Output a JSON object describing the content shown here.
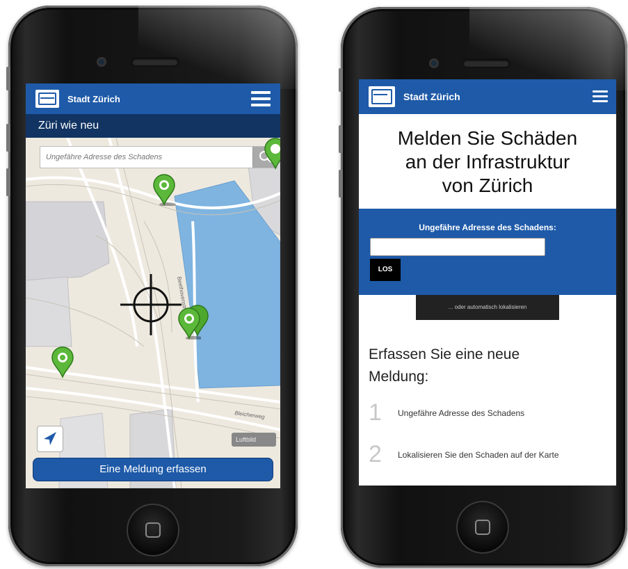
{
  "left_app": {
    "brand": "Stadt Zürich",
    "subtitle": "Züri wie neu",
    "search_placeholder": "Ungefähre Adresse des Schadens",
    "layer_toggle": "Luftbild",
    "street_labels": [
      "Beethovenstrasse",
      "Bleicherweg"
    ],
    "report_button": "Eine Meldung erfassen"
  },
  "right_app": {
    "brand": "Stadt Zürich",
    "headline": [
      "Melden Sie Schäden",
      "an der Infrastruktur",
      "von Zürich"
    ],
    "address_label": "Ungefähre Adresse des Schadens:",
    "address_value": "",
    "go_button": "LOS",
    "auto_locate_button": "... oder automatisch lokalisieren",
    "section_title": "Erfassen Sie eine neue Meldung:",
    "steps": [
      {
        "num": "1",
        "text": "Ungefähre Adresse des Schadens"
      },
      {
        "num": "2",
        "text": "Lokalisieren Sie den Schaden auf der Karte"
      }
    ]
  },
  "colors": {
    "brand_blue": "#1e5aa8",
    "dark_navy": "#113463",
    "pin_green": "#5cb83a",
    "water": "#7fb4e0"
  },
  "icons": [
    "menu-icon",
    "search-icon",
    "map-pin-icon",
    "crosshair-icon",
    "location-arrow-icon",
    "city-crest-icon",
    "home-button-icon"
  ]
}
